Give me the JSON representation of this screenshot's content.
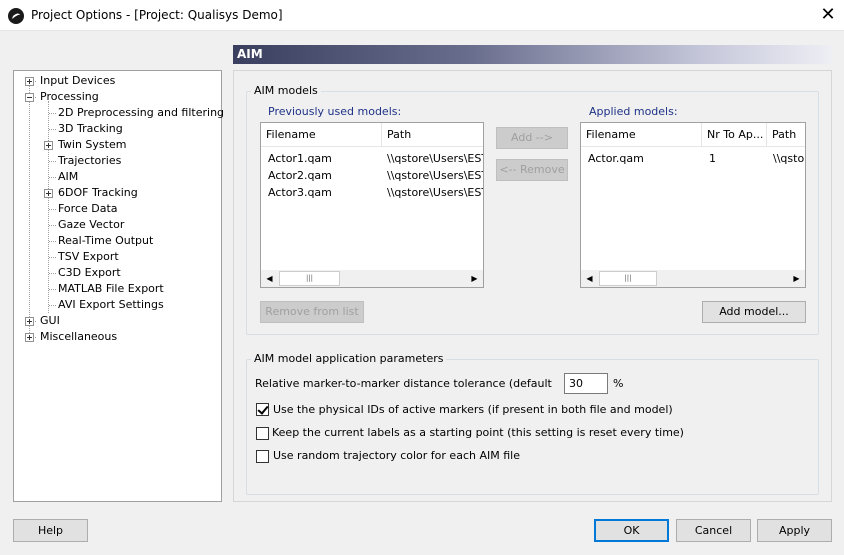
{
  "window": {
    "title": "Project Options - [Project: Qualisys Demo]"
  },
  "tree": [
    {
      "label": "Input Devices",
      "level": 0,
      "expander": "plus"
    },
    {
      "label": "Processing",
      "level": 0,
      "expander": "minus"
    },
    {
      "label": "2D Preprocessing and filtering",
      "level": 1,
      "expander": ""
    },
    {
      "label": "3D Tracking",
      "level": 1,
      "expander": ""
    },
    {
      "label": "Twin System",
      "level": 1,
      "expander": "plus"
    },
    {
      "label": "Trajectories",
      "level": 1,
      "expander": ""
    },
    {
      "label": "AIM",
      "level": 1,
      "expander": ""
    },
    {
      "label": "6DOF Tracking",
      "level": 1,
      "expander": "plus"
    },
    {
      "label": "Force Data",
      "level": 1,
      "expander": ""
    },
    {
      "label": "Gaze Vector",
      "level": 1,
      "expander": ""
    },
    {
      "label": "Real-Time Output",
      "level": 1,
      "expander": ""
    },
    {
      "label": "TSV Export",
      "level": 1,
      "expander": ""
    },
    {
      "label": "C3D Export",
      "level": 1,
      "expander": ""
    },
    {
      "label": "MATLAB File Export",
      "level": 1,
      "expander": ""
    },
    {
      "label": "AVI Export Settings",
      "level": 1,
      "expander": ""
    },
    {
      "label": "GUI",
      "level": 0,
      "expander": "plus"
    },
    {
      "label": "Miscellaneous",
      "level": 0,
      "expander": "plus"
    }
  ],
  "page": {
    "header": "AIM"
  },
  "models": {
    "group_title": "AIM models",
    "previous_label": "Previously used models:",
    "applied_label": "Applied models:",
    "previous_columns": [
      "Filename",
      "Path"
    ],
    "previous_rows": [
      [
        "Actor1.qam",
        "\\\\qstore\\Users\\EST\\"
      ],
      [
        "Actor2.qam",
        "\\\\qstore\\Users\\EST\\"
      ],
      [
        "Actor3.qam",
        "\\\\qstore\\Users\\EST\\"
      ]
    ],
    "applied_columns": [
      "Filename",
      "Nr To Ap...",
      "Path"
    ],
    "applied_rows": [
      [
        "Actor.qam",
        "1",
        "\\\\qstor"
      ]
    ],
    "add_button": "Add -->",
    "remove_button": "<-- Remove",
    "remove_from_list_button": "Remove from list",
    "add_model_button": "Add model..."
  },
  "params": {
    "group_title": "AIM model application parameters",
    "tolerance_label": "Relative marker-to-marker distance tolerance (default",
    "tolerance_value": "30",
    "tolerance_unit": "%",
    "options": [
      {
        "label": "Use the physical IDs of active markers (if present in both file and model)",
        "checked": true
      },
      {
        "label": "Keep the current labels as a starting point (this setting is reset every time)",
        "checked": false
      },
      {
        "label": "Use random trajectory color for each AIM file",
        "checked": false
      }
    ]
  },
  "footer": {
    "help": "Help",
    "ok": "OK",
    "cancel": "Cancel",
    "apply": "Apply"
  }
}
